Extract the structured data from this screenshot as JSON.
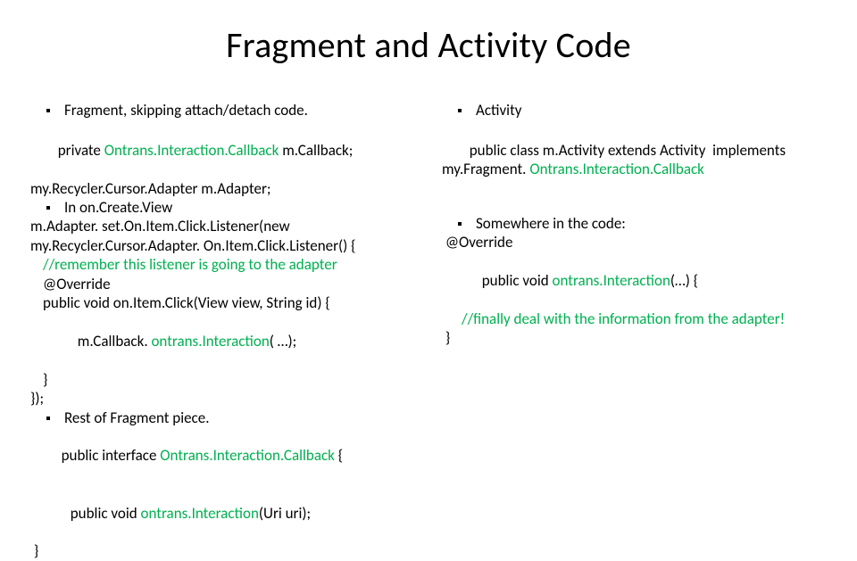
{
  "title": "Fragment and Activity Code",
  "left": {
    "b1": "Fragment, skipping attach/detach code.",
    "l1a": "private ",
    "l1b": "Ontrans.Interaction.Callback ",
    "l1c": "m.Callback",
    "l1d": ";",
    "l2": "my.Recycler.Cursor.Adapter m.Adapter;",
    "b2": "In on.Create.View",
    "l3": "m.Adapter. set.On.Item.Click.Listener(new my.Recycler.Cursor.Adapter. On.Item.Click.Listener() {",
    "l4": "//remember this listener is going to the adapter",
    "l5": "@Override",
    "l6": "public void on.Item.Click(View view, String id) {",
    "l7a": "m.Callback",
    "l7b": ". ",
    "l7c": "ontrans.Interaction",
    "l7d": "( …);",
    "l8": "}",
    "l9": "});",
    "b3": "Rest of Fragment piece.",
    "l10a": " public interface ",
    "l10b": "Ontrans.Interaction.Callback ",
    "l10c": "{",
    "l11a": "public void ",
    "l11b": "ontrans.Interaction",
    "l11c": "(Uri uri);",
    "l12": " }"
  },
  "right": {
    "b1": "Activity",
    "l1a": "public class m.Activity extends Activity  implements my.Fragment. ",
    "l1b": "Ontrans.Interaction.Callback",
    "b2": "Somewhere in the code:",
    "l2": " @Override",
    "l3a": "public void ",
    "l3b": "ontrans.Interaction",
    "l3c": "(…) {",
    "l4": "//finally deal with the information from the adapter!",
    "l5": " }"
  }
}
